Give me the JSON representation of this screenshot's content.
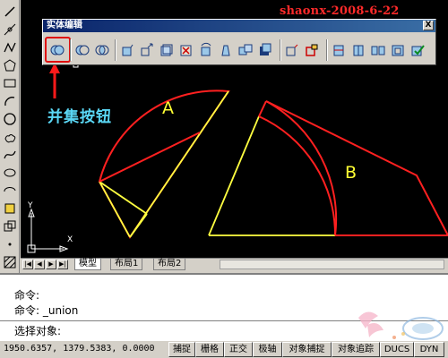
{
  "watermark_title": "shaonx-2008-6-22",
  "toolbar": {
    "title": "实体编辑",
    "close_label": "X",
    "buttons": [
      {
        "name": "union-icon",
        "highlighted": true
      },
      {
        "name": "subtract-icon"
      },
      {
        "name": "intersect-icon"
      },
      {
        "name": "extrude-faces-icon"
      },
      {
        "name": "move-faces-icon"
      },
      {
        "name": "offset-faces-icon"
      },
      {
        "name": "delete-faces-icon"
      },
      {
        "name": "rotate-faces-icon"
      },
      {
        "name": "taper-faces-icon"
      },
      {
        "name": "copy-faces-icon"
      },
      {
        "name": "color-faces-icon"
      },
      {
        "name": "copy-edges-icon"
      },
      {
        "name": "color-edges-icon"
      },
      {
        "name": "imprint-icon"
      },
      {
        "name": "clean-icon"
      },
      {
        "name": "separate-icon"
      },
      {
        "name": "shell-icon"
      },
      {
        "name": "check-icon"
      }
    ]
  },
  "annotation": {
    "label": "并集按钮",
    "color": "#5ad7f5"
  },
  "shapes": {
    "label_a": "A",
    "label_b": "B",
    "shape_a_color": "#ff2020",
    "shape_b_color": "#ff2020",
    "inner_lines_color": "#ffff40"
  },
  "axis": {
    "y_label": "Y",
    "x_label": "X"
  },
  "layout_tabs": {
    "arrows": [
      "|◀",
      "◀",
      "▶",
      "▶|"
    ],
    "tabs": [
      {
        "label": "模型",
        "active": true
      },
      {
        "label": "布局1",
        "active": false
      },
      {
        "label": "布局2",
        "active": false
      }
    ]
  },
  "command": {
    "history": [
      "命令:",
      "命令: _union"
    ],
    "prompt": "选择对象:"
  },
  "status": {
    "coords": "1950.6357, 1379.5383, 0.0000",
    "toggles": [
      "捕捉",
      "栅格",
      "正交",
      "极轴",
      "对象捕捉",
      "对象追踪",
      "DUCS",
      "DYN"
    ]
  },
  "left_toolbar": {
    "icons": [
      "line-icon",
      "construction-line-icon",
      "polyline-icon",
      "polygon-icon",
      "rectangle-icon",
      "arc-icon",
      "circle-icon",
      "revision-cloud-icon",
      "spline-icon",
      "ellipse-icon",
      "ellipse-arc-icon",
      "insert-block-icon",
      "make-block-icon",
      "point-icon",
      "hatch-icon",
      "gradient-icon"
    ]
  }
}
